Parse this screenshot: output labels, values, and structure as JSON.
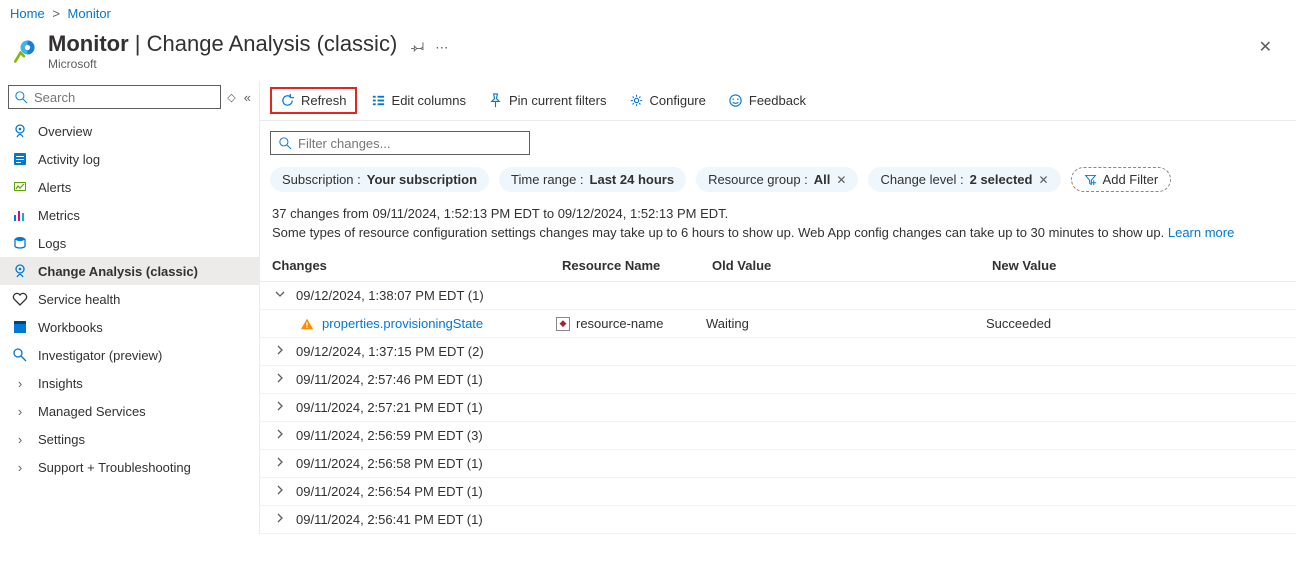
{
  "breadcrumb": {
    "home": "Home",
    "monitor": "Monitor"
  },
  "header": {
    "title_main": "Monitor",
    "title_sep": " | ",
    "title_sub": "Change Analysis (classic)",
    "publisher": "Microsoft"
  },
  "sidebar": {
    "search_placeholder": "Search",
    "items": [
      {
        "label": "Overview"
      },
      {
        "label": "Activity log"
      },
      {
        "label": "Alerts"
      },
      {
        "label": "Metrics"
      },
      {
        "label": "Logs"
      },
      {
        "label": "Change Analysis (classic)"
      },
      {
        "label": "Service health"
      },
      {
        "label": "Workbooks"
      },
      {
        "label": "Investigator (preview)"
      },
      {
        "label": "Insights"
      },
      {
        "label": "Managed Services"
      },
      {
        "label": "Settings"
      },
      {
        "label": "Support + Troubleshooting"
      }
    ]
  },
  "toolbar": {
    "refresh": "Refresh",
    "edit_columns": "Edit columns",
    "pin_filters": "Pin current filters",
    "configure": "Configure",
    "feedback": "Feedback"
  },
  "filter": {
    "placeholder": "Filter changes..."
  },
  "pills": {
    "subscription_label": "Subscription : ",
    "subscription_value": "Your subscription",
    "timerange_label": "Time range : ",
    "timerange_value": "Last 24 hours",
    "rg_label": "Resource group : ",
    "rg_value": "All",
    "level_label": "Change level : ",
    "level_value": "2 selected",
    "add_filter": "Add Filter"
  },
  "info": {
    "line1": "37 changes from 09/11/2024, 1:52:13 PM EDT to 09/12/2024, 1:52:13 PM EDT.",
    "line2_text": "Some types of resource configuration settings changes may take up to 6 hours to show up. Web App config changes can take up to 30 minutes to show up. ",
    "learn_more": "Learn more"
  },
  "columns": {
    "changes": "Changes",
    "resource": "Resource Name",
    "old": "Old Value",
    "new": "New Value"
  },
  "rows": [
    {
      "expanded": true,
      "time": "09/12/2024, 1:38:07 PM EDT",
      "count": "(1)",
      "children": [
        {
          "property": "properties.provisioningState",
          "resource": "resource-name",
          "old": "Waiting",
          "new": "Succeeded"
        }
      ]
    },
    {
      "expanded": false,
      "time": "09/12/2024, 1:37:15 PM EDT",
      "count": "(2)"
    },
    {
      "expanded": false,
      "time": "09/11/2024, 2:57:46 PM EDT",
      "count": "(1)"
    },
    {
      "expanded": false,
      "time": "09/11/2024, 2:57:21 PM EDT",
      "count": "(1)"
    },
    {
      "expanded": false,
      "time": "09/11/2024, 2:56:59 PM EDT",
      "count": "(3)"
    },
    {
      "expanded": false,
      "time": "09/11/2024, 2:56:58 PM EDT",
      "count": "(1)"
    },
    {
      "expanded": false,
      "time": "09/11/2024, 2:56:54 PM EDT",
      "count": "(1)"
    },
    {
      "expanded": false,
      "time": "09/11/2024, 2:56:41 PM EDT",
      "count": "(1)"
    }
  ]
}
